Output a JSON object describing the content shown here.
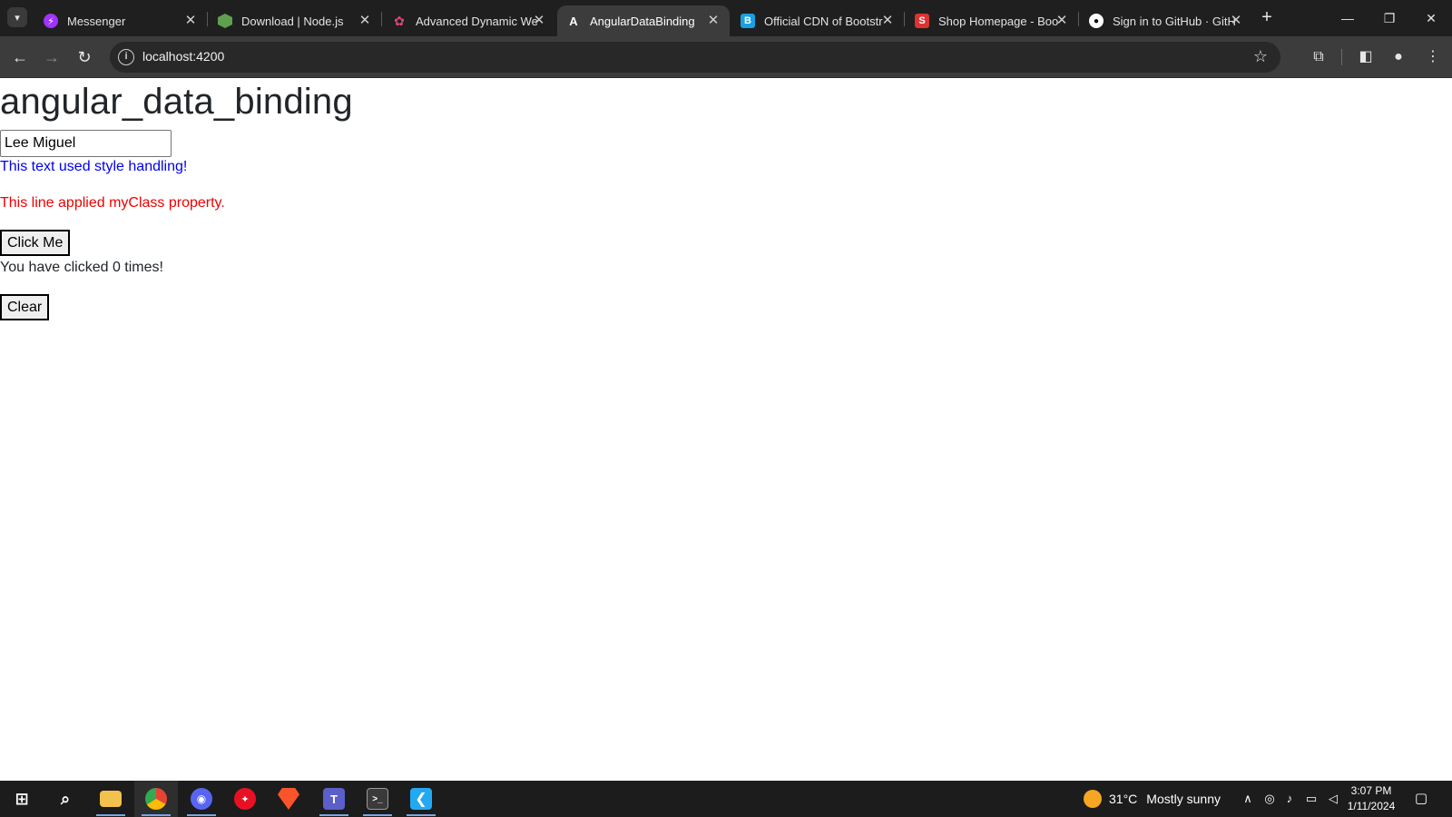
{
  "browser": {
    "tabs": [
      {
        "title": "Messenger",
        "icon": "messenger-icon",
        "color": "#a033ff"
      },
      {
        "title": "Download | Node.js",
        "icon": "nodejs-icon",
        "color": "#5fa04e"
      },
      {
        "title": "Advanced Dynamic We",
        "icon": "page-icon",
        "color": "#e0457b"
      },
      {
        "title": "AngularDataBinding",
        "icon": "angular-icon",
        "color": "#ffffff",
        "active": true
      },
      {
        "title": "Official CDN of Bootstr",
        "icon": "bootstrap-icon",
        "color": "#1a9fe0"
      },
      {
        "title": "Shop Homepage - Boo",
        "icon": "startbootstrap-icon",
        "color": "#dd3333"
      },
      {
        "title": "Sign in to GitHub · GitH",
        "icon": "github-icon",
        "color": "#ffffff"
      }
    ],
    "url": "localhost:4200"
  },
  "page": {
    "heading": "angular_data_binding",
    "name_value": "Lee Miguel",
    "styled_text": "This text used style handling!",
    "class_text": "This line applied myClass property.",
    "click_button": "Click Me",
    "click_count_text": "You have clicked 0 times!",
    "clear_button": "Clear"
  },
  "taskbar": {
    "apps": [
      {
        "name": "file-explorer-icon",
        "color": "#f2c14e"
      },
      {
        "name": "chrome-icon",
        "color": "#4285f4",
        "active": true
      },
      {
        "name": "discord-icon",
        "color": "#5865f2"
      },
      {
        "name": "app-red-icon",
        "color": "#e81123"
      },
      {
        "name": "brave-icon",
        "color": "#fb542b"
      },
      {
        "name": "teams-icon",
        "color": "#5b5fc7"
      },
      {
        "name": "terminal-icon",
        "color": "#3a3a3a"
      },
      {
        "name": "vscode-icon",
        "color": "#23a9f2"
      }
    ],
    "weather_temp": "31°C",
    "weather_desc": "Mostly sunny",
    "time": "3:07 PM",
    "date": "1/11/2024"
  }
}
